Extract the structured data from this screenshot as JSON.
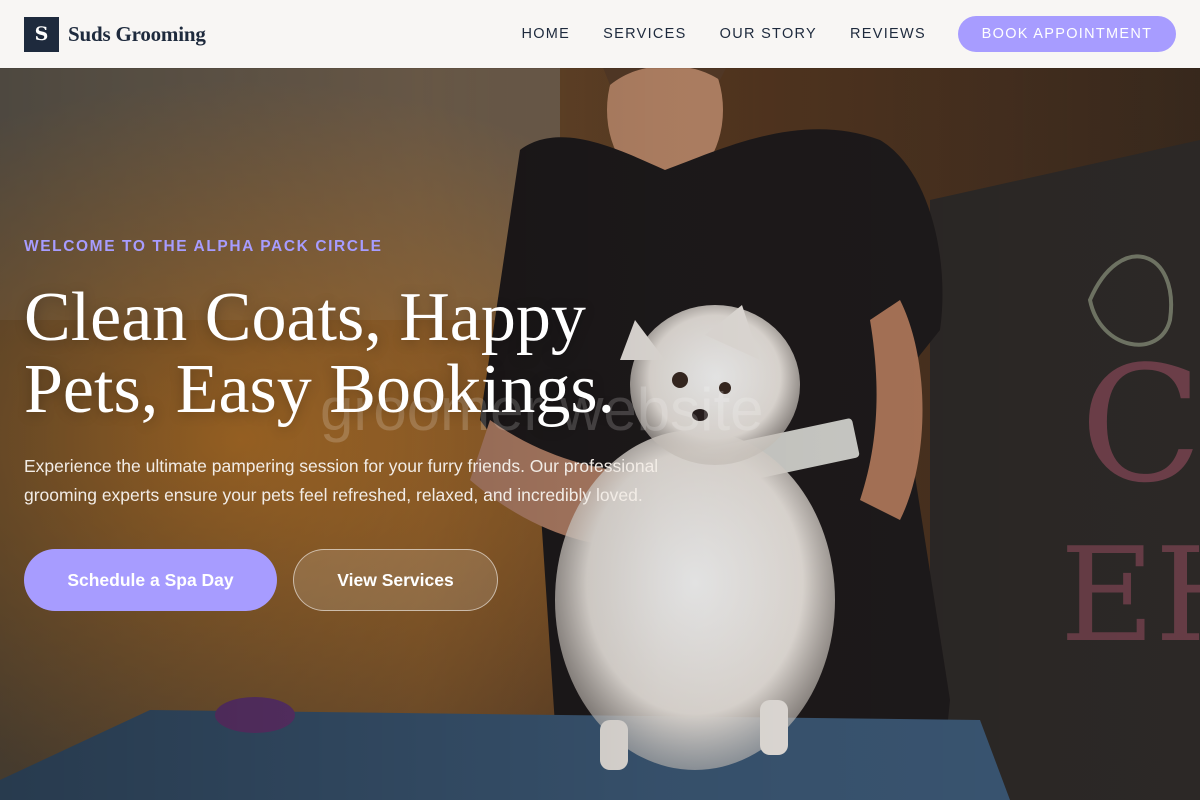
{
  "brand": {
    "logo_letter": "S",
    "name": "Suds Grooming",
    "navy": "#1e2a3d",
    "accent": "#a79cff"
  },
  "nav": {
    "links": [
      "HOME",
      "SERVICES",
      "OUR STORY",
      "REVIEWS"
    ],
    "cta": "BOOK APPOINTMENT"
  },
  "hero": {
    "eyebrow": "WELCOME TO THE ALPHA PACK CIRCLE",
    "headline": "Clean Coats, Happy Pets, Easy Bookings.",
    "subtext": "Experience the ultimate pampering session for your furry friends. Our professional grooming experts ensure your pets feel refreshed, relaxed, and incredibly loved.",
    "primary_button": "Schedule a Spa Day",
    "secondary_button": "View Services",
    "watermark": "groomer website",
    "image_description": "groomer combing a small white fluffy dog on a grooming table"
  }
}
